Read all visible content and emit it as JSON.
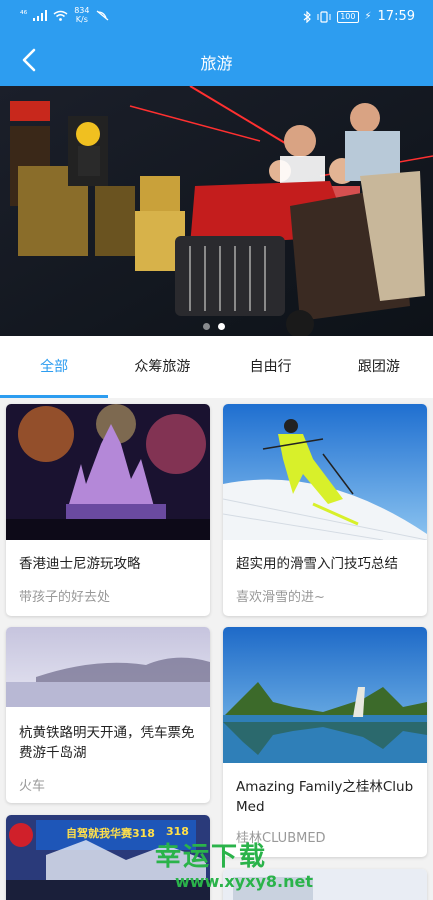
{
  "status_bar": {
    "signal": "⁴⁶",
    "net_speed_value": "834",
    "net_speed_unit": "K/s",
    "battery": "100",
    "time": "17:59"
  },
  "nav": {
    "title": "旅游"
  },
  "banner": {
    "dots": 2,
    "active_dot": 2
  },
  "tabs": [
    {
      "label": "全部"
    },
    {
      "label": "众筹旅游"
    },
    {
      "label": "自由行"
    },
    {
      "label": "跟团游"
    }
  ],
  "cards": [
    {
      "title": "香港迪士尼游玩攻略",
      "subtitle": "带孩子的好去处"
    },
    {
      "title": "超实用的滑雪入门技巧总结",
      "subtitle": "喜欢滑雪的进~"
    },
    {
      "title": "杭黄铁路明天开通，凭车票免费游千岛湖",
      "subtitle": "火车"
    },
    {
      "title": "Amazing Family之桂林Club Med",
      "subtitle": "桂林CLUBMED"
    }
  ],
  "poster": {
    "title": "自驾就我华赛318",
    "number": "318"
  },
  "watermark": {
    "text": "幸运下载",
    "url": "www.xyxy8.net"
  },
  "colors": {
    "accent": "#2d9df0",
    "watermark": "#2ab34a"
  }
}
